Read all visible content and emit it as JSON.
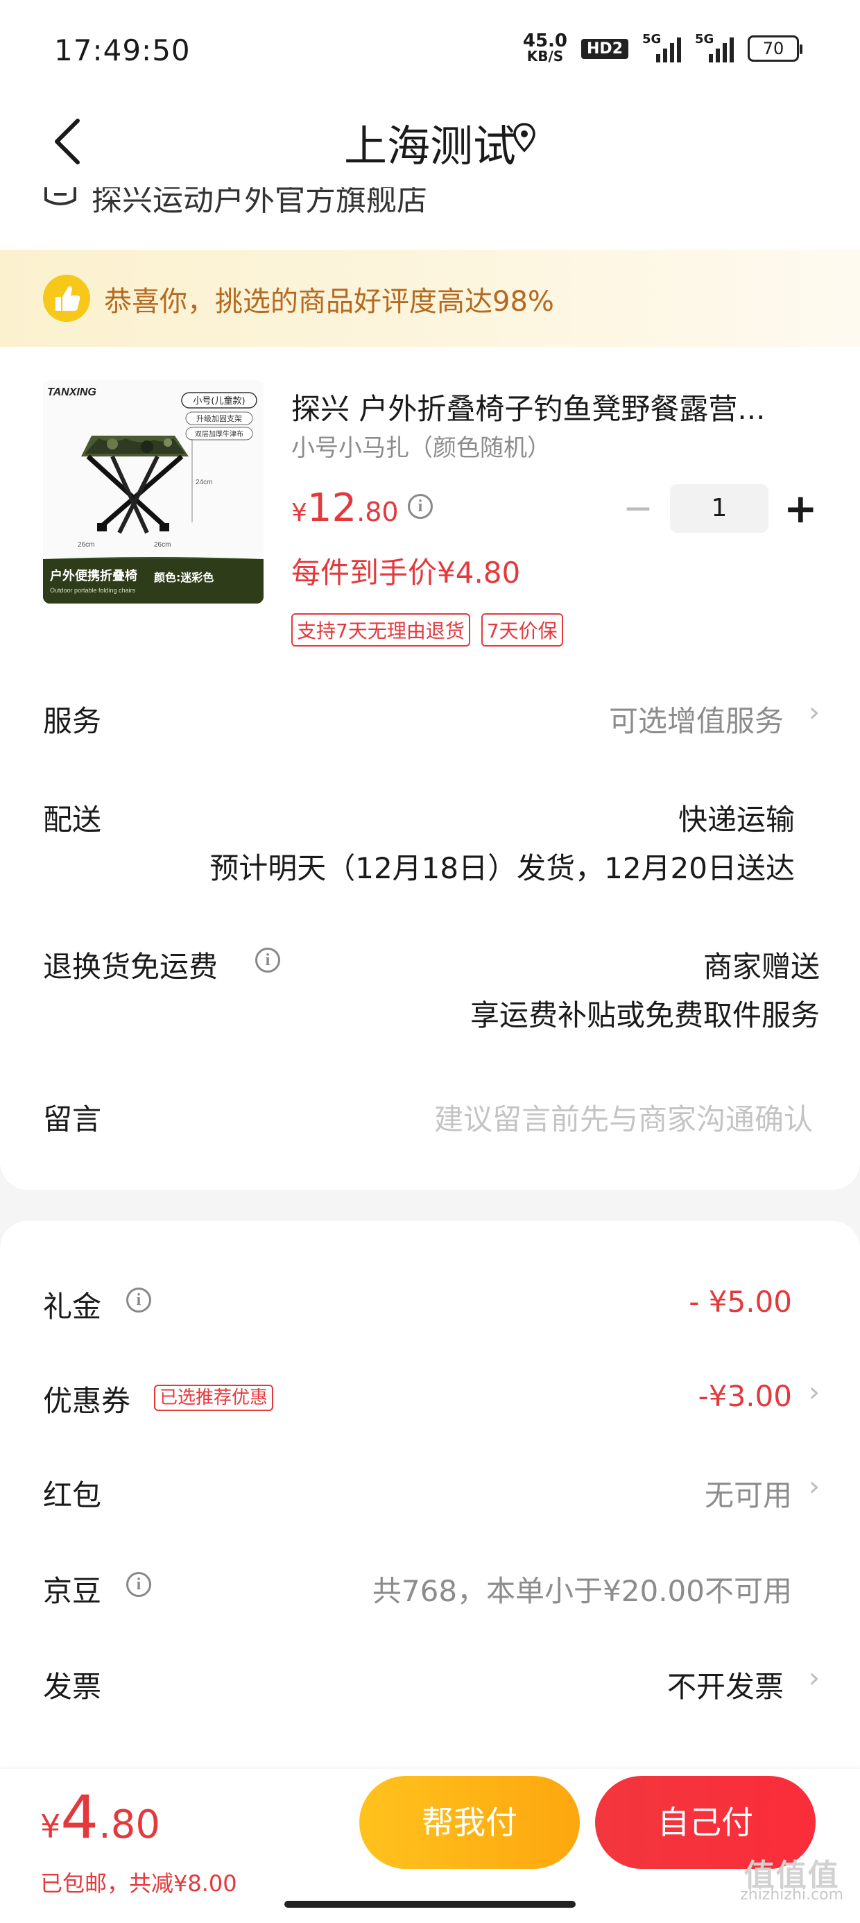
{
  "status_bar": {
    "time": "17:49:50",
    "net_speed_value": "45.0",
    "net_speed_unit": "KB/S",
    "hd_label": "HD2",
    "sim1_label": "5G",
    "sim2_label": "5G",
    "battery": "70"
  },
  "header": {
    "title": "上海测试",
    "back_icon": "chevron-left-icon",
    "location_icon": "location-pin-icon"
  },
  "store": {
    "name": "探兴运动户外官方旗舰店"
  },
  "banner": {
    "text": "恭喜你，挑选的商品好评度高达98%",
    "icon": "thumbs-up-icon"
  },
  "product": {
    "title": "探兴 户外折叠椅子钓鱼凳野餐露营...",
    "spec": "小号小马扎（颜色随机）",
    "price_currency": "¥",
    "price_int": "12",
    "price_dec": ".80",
    "quantity": "1",
    "minus_label": "−",
    "plus_label": "+",
    "unit_price": "每件到手价¥4.80",
    "tags": [
      "支持7天无理由退货",
      "7天价保"
    ],
    "image_brand": "TANXING",
    "image_labels": [
      "小号(儿童款)",
      "升级加固支架",
      "双层加厚牛津布"
    ],
    "image_caption": "户外便携折叠椅",
    "image_color": "颜色:迷彩色",
    "image_sub": "Outdoor portable folding chairs",
    "image_dims": [
      "24cm",
      "26cm",
      "26cm"
    ]
  },
  "rows": {
    "service_label": "服务",
    "service_value": "可选增值服务",
    "delivery_label": "配送",
    "delivery_value": "快递运输",
    "delivery_note": "预计明天（12月18日）发货，12月20日送达",
    "return_label": "退换货免运费",
    "return_value": "商家赠送",
    "return_note": "享运费补贴或免费取件服务",
    "message_label": "留言",
    "message_placeholder": "建议留言前先与商家沟通确认"
  },
  "discounts": {
    "gift_label": "礼金",
    "gift_value": "- ¥5.00",
    "coupon_label": "优惠券",
    "coupon_tag": "已选推荐优惠",
    "coupon_value": "-¥3.00",
    "redpacket_label": "红包",
    "redpacket_value": "无可用",
    "jingdou_label": "京豆",
    "jingdou_value": "共768，本单小于¥20.00不可用",
    "invoice_label": "发票",
    "invoice_value": "不开发票"
  },
  "bottom": {
    "total_currency": "¥",
    "total_int": "4",
    "total_dec": ".80",
    "sub_text": "已包邮，共减¥8.00",
    "help_pay_label": "帮我付",
    "self_pay_label": "自己付",
    "watermark_top": "值值值",
    "watermark_bottom": "zhizhizhi.com"
  },
  "colors": {
    "accent_red": "#e4393c",
    "banner_text": "#b46a20",
    "help_button": "#ffc21d",
    "self_button": "#f3363d"
  }
}
